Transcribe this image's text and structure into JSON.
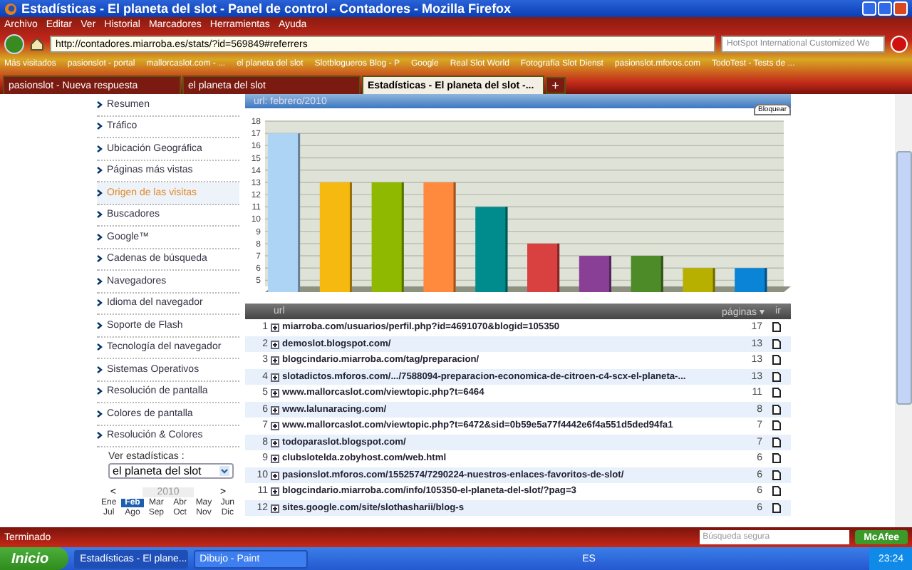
{
  "window": {
    "title": "Estadísticas - El planeta del slot - Panel de control - Contadores - Mozilla Firefox"
  },
  "menu": [
    "Archivo",
    "Editar",
    "Ver",
    "Historial",
    "Marcadores",
    "Herramientas",
    "Ayuda"
  ],
  "address_bar": {
    "value": "http://contadores.miarroba.es/stats/?id=569849#referrers"
  },
  "search_bar": {
    "placeholder": "HotSpot International Customized We"
  },
  "bookmarks": [
    "Más visitados",
    "pasionslot - portal",
    "mallorcaslot.com - ...",
    "el planeta del slot",
    "Slotblogueros Blog - P",
    "Google",
    "Real Slot World",
    "Fotografía Slot Dienst",
    "pasionslot.mforos.com",
    "TodoTest - Tests de ..."
  ],
  "tabs": [
    {
      "label": "pasionslot - Nueva respuesta",
      "selected": false
    },
    {
      "label": "el planeta del slot",
      "selected": false
    },
    {
      "label": "Estadísticas - El planeta del slot -...",
      "selected": true
    }
  ],
  "new_tab": "+",
  "sidebar": {
    "items": [
      {
        "label": "Resumen",
        "selected": false
      },
      {
        "label": "Tráfico",
        "selected": false
      },
      {
        "label": "Ubicación Geográfica",
        "selected": false
      },
      {
        "label": "Páginas más vistas",
        "selected": false
      },
      {
        "label": "Origen de las visitas",
        "selected": true
      },
      {
        "label": "Buscadores",
        "selected": false
      },
      {
        "label": "Google™",
        "selected": false
      },
      {
        "label": "Cadenas de búsqueda",
        "selected": false
      },
      {
        "label": "Navegadores",
        "selected": false
      },
      {
        "label": "Idioma del navegador",
        "selected": false
      },
      {
        "label": "Soporte de Flash",
        "selected": false
      },
      {
        "label": "Tecnología del navegador",
        "selected": false
      },
      {
        "label": "Sistemas Operativos",
        "selected": false
      },
      {
        "label": "Resolución de pantalla",
        "selected": false
      },
      {
        "label": "Colores de pantalla",
        "selected": false
      },
      {
        "label": "Resolución & Colores",
        "selected": false
      }
    ],
    "site_select": {
      "label": "Ver estadísticas :",
      "value": "el planeta del slot"
    },
    "calendar": {
      "prev": "<",
      "year": "2010",
      "next": ">",
      "months": [
        {
          "label": "Ene",
          "selected": false
        },
        {
          "label": "Feb",
          "selected": true
        },
        {
          "label": "Mar",
          "selected": false
        },
        {
          "label": "Abr",
          "selected": false
        },
        {
          "label": "May",
          "selected": false
        },
        {
          "label": "Jun",
          "selected": false
        },
        {
          "label": "Jul",
          "selected": false
        },
        {
          "label": "Ago",
          "selected": false
        },
        {
          "label": "Sep",
          "selected": false
        },
        {
          "label": "Oct",
          "selected": false
        },
        {
          "label": "Nov",
          "selected": false
        },
        {
          "label": "Dic",
          "selected": false
        }
      ]
    }
  },
  "panel": {
    "title": "url: febrero/2010",
    "lock_button": "Bloquear",
    "chart_data": {
      "type": "bar",
      "grid": true,
      "values": [
        17,
        13,
        13,
        13,
        11,
        8,
        7,
        7,
        6,
        6
      ],
      "colors": [
        "#aed4f5",
        "#f5b90f",
        "#8fb800",
        "#ff8a3d",
        "#008c8c",
        "#d94040",
        "#8a3f96",
        "#4d8a28",
        "#b8b000",
        "#0a84d6"
      ],
      "ylim": [
        4.5,
        18
      ],
      "yticks": [
        5,
        6,
        7,
        8,
        9,
        10,
        11,
        12,
        13,
        14,
        15,
        16,
        17,
        18
      ]
    }
  },
  "table": {
    "columns": [
      "url",
      "páginas ▾",
      "ir"
    ],
    "rows": [
      {
        "n": "1",
        "url": "miarroba.com/usuarios/perfil.php?id=4691070&blogid=105350",
        "pages": "17"
      },
      {
        "n": "2",
        "url": "demoslot.blogspot.com/",
        "pages": "13"
      },
      {
        "n": "3",
        "url": "blogcindario.miarroba.com/tag/preparacion/",
        "pages": "13"
      },
      {
        "n": "4",
        "url": "slotadictos.mforos.com/.../7588094-preparacion-economica-de-citroen-c4-scx-el-planeta-...",
        "pages": "13"
      },
      {
        "n": "5",
        "url": "www.mallorcaslot.com/viewtopic.php?t=6464",
        "pages": "11"
      },
      {
        "n": "6",
        "url": "www.lalunaracing.com/",
        "pages": "8"
      },
      {
        "n": "7",
        "url": "www.mallorcaslot.com/viewtopic.php?t=6472&sid=0b59e5a77f4442e6f4a551d5ded94fa1",
        "pages": "7"
      },
      {
        "n": "8",
        "url": "todoparaslot.blogspot.com/",
        "pages": "7"
      },
      {
        "n": "9",
        "url": "clubslotelda.zobyhost.com/web.html",
        "pages": "6"
      },
      {
        "n": "10",
        "url": "pasionslot.mforos.com/1552574/7290224-nuestros-enlaces-favoritos-de-slot/",
        "pages": "6"
      },
      {
        "n": "11",
        "url": "blogcindario.miarroba.com/info/105350-el-planeta-del-slot/?pag=3",
        "pages": "6"
      },
      {
        "n": "12",
        "url": "sites.google.com/site/slothasharii/blog-s",
        "pages": "6"
      }
    ]
  },
  "status_bar": {
    "text": "Terminado",
    "search_placeholder": "Búsqueda segura",
    "mcafee": "McAfee"
  },
  "taskbar": {
    "start": "Inicio",
    "windows": [
      {
        "label": "Estadísticas - El plane...",
        "selected": true
      },
      {
        "label": "Dibujo - Paint",
        "selected": false
      }
    ],
    "language": "ES",
    "clock": "23:24"
  }
}
